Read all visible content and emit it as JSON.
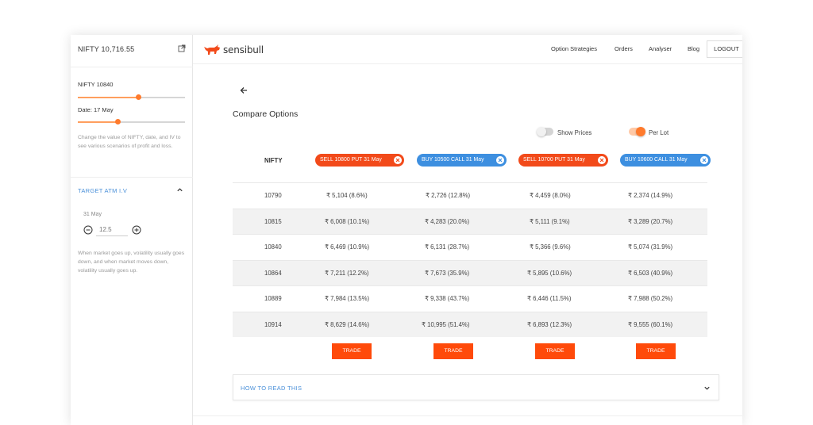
{
  "sidebar": {
    "nifty_header": "NIFTY 10,716.55",
    "nifty_slider_label": "NIFTY 10840",
    "nifty_slider_value": 0.56,
    "date_slider_label": "Date: 17 May",
    "date_slider_value": 0.37,
    "help_text": "Change the value of NIFTY, date, and IV to see various scenarios of profit and loss.",
    "atm_title": "TARGET ATM I.V",
    "atm_date": "31 May",
    "iv_placeholder": "12.5",
    "volatility_note": "When market goes up, volatility usually goes down, and when market moves down, volatility usually goes up."
  },
  "topnav": {
    "logo_text": "sensibull",
    "links": [
      "Option Strategies",
      "Orders",
      "Analyser",
      "Blog"
    ],
    "logout_label": "LOGOUT"
  },
  "main": {
    "title": "Compare Options",
    "show_prices_label": "Show Prices",
    "show_prices_on": false,
    "per_lot_label": "Per Lot",
    "per_lot_on": true,
    "nifty_column": "NIFTY",
    "options": [
      {
        "label": "SELL 10800 PUT 31 May",
        "side": "sell"
      },
      {
        "label": "BUY 10500 CALL 31 May",
        "side": "buy"
      },
      {
        "label": "SELL 10700 PUT 31 May",
        "side": "sell"
      },
      {
        "label": "BUY 10600 CALL 31 May",
        "side": "buy"
      }
    ],
    "rows": [
      {
        "nifty": "10790",
        "values": [
          "₹ 5,104 (8.6%)",
          "₹ 2,726 (12.8%)",
          "₹ 4,459 (8.0%)",
          "₹ 2,374 (14.9%)"
        ]
      },
      {
        "nifty": "10815",
        "values": [
          "₹ 6,008 (10.1%)",
          "₹ 4,283 (20.0%)",
          "₹ 5,111 (9.1%)",
          "₹ 3,289 (20.7%)"
        ]
      },
      {
        "nifty": "10840",
        "values": [
          "₹ 6,469 (10.9%)",
          "₹ 6,131 (28.7%)",
          "₹ 5,366 (9.6%)",
          "₹ 5,074 (31.9%)"
        ]
      },
      {
        "nifty": "10864",
        "values": [
          "₹ 7,211 (12.2%)",
          "₹ 7,673 (35.9%)",
          "₹ 5,895 (10.6%)",
          "₹ 6,503 (40.9%)"
        ]
      },
      {
        "nifty": "10889",
        "values": [
          "₹ 7,984 (13.5%)",
          "₹ 9,338 (43.7%)",
          "₹ 6,446 (11.5%)",
          "₹ 7,988 (50.2%)"
        ]
      },
      {
        "nifty": "10914",
        "values": [
          "₹ 8,629 (14.6%)",
          "₹ 10,995 (51.4%)",
          "₹ 6,893 (12.3%)",
          "₹ 9,555 (60.1%)"
        ]
      }
    ],
    "trade_label": "TRADE",
    "howto_label": "HOW TO READ THIS"
  },
  "colors": {
    "accent_orange": "#ff4a0a",
    "sell_chip": "#f24a1a",
    "buy_chip": "#3d8fe0",
    "link_blue": "#4a90d9",
    "slider_thumb": "#ff7a2c"
  },
  "icons": {
    "external_link": "external-link-icon",
    "chevron_up": "chevron-up-icon",
    "chevron_down": "chevron-down-icon",
    "back_arrow": "arrow-left-icon",
    "minus": "minus-circle-icon",
    "plus": "plus-circle-icon",
    "remove_chip": "close-circle-icon",
    "logo": "bull-logo-icon"
  }
}
